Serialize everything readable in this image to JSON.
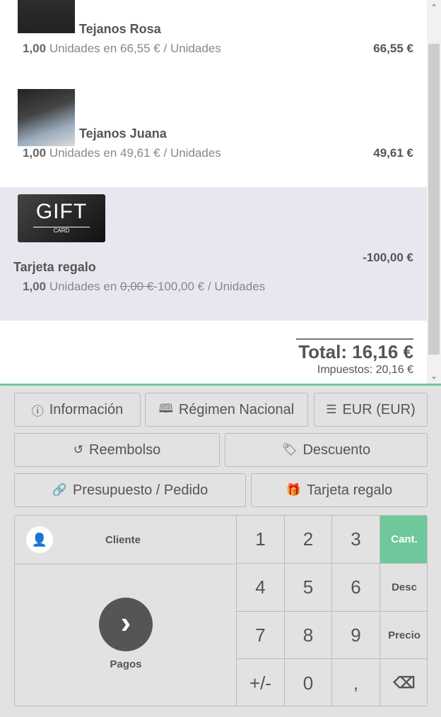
{
  "orderlines": [
    {
      "name": "Tejanos Rosa",
      "qty": "1,00",
      "unit_text": "Unidades en",
      "unit_price": "66,55 €",
      "per": "/ Unidades",
      "price": "66,55 €"
    },
    {
      "name": "Tejanos Juana",
      "qty": "1,00",
      "unit_text": "Unidades en",
      "unit_price": "49,61 €",
      "per": "/ Unidades",
      "price": "49,61 €"
    },
    {
      "name": "Tarjeta regalo",
      "qty": "1,00",
      "unit_text": "Unidades en",
      "old_price": "0,00 €",
      "unit_price": "-100,00 €",
      "per": "/ Unidades",
      "price": "-100,00 €",
      "image_text": "GIFT",
      "image_subtext": "CARD"
    }
  ],
  "totals": {
    "total": "Total: 16,16 €",
    "taxes": "Impuestos: 20,16 €"
  },
  "buttons": {
    "info": "Información",
    "regime": "Régimen Nacional",
    "currency": "EUR (EUR)",
    "refund": "Reembolso",
    "discount": "Descuento",
    "quote": "Presupuesto / Pedido",
    "giftcard": "Tarjeta regalo"
  },
  "numpad": {
    "customer": "Cliente",
    "payment": "Pagos",
    "keys": [
      "1",
      "2",
      "3",
      "4",
      "5",
      "6",
      "7",
      "8",
      "9",
      "+/-",
      "0",
      ","
    ],
    "modes": [
      "Cant.",
      "Desc",
      "Precio"
    ]
  },
  "colors": {
    "accent": "#6ec89b",
    "selected_line": "#e7e7ef"
  }
}
